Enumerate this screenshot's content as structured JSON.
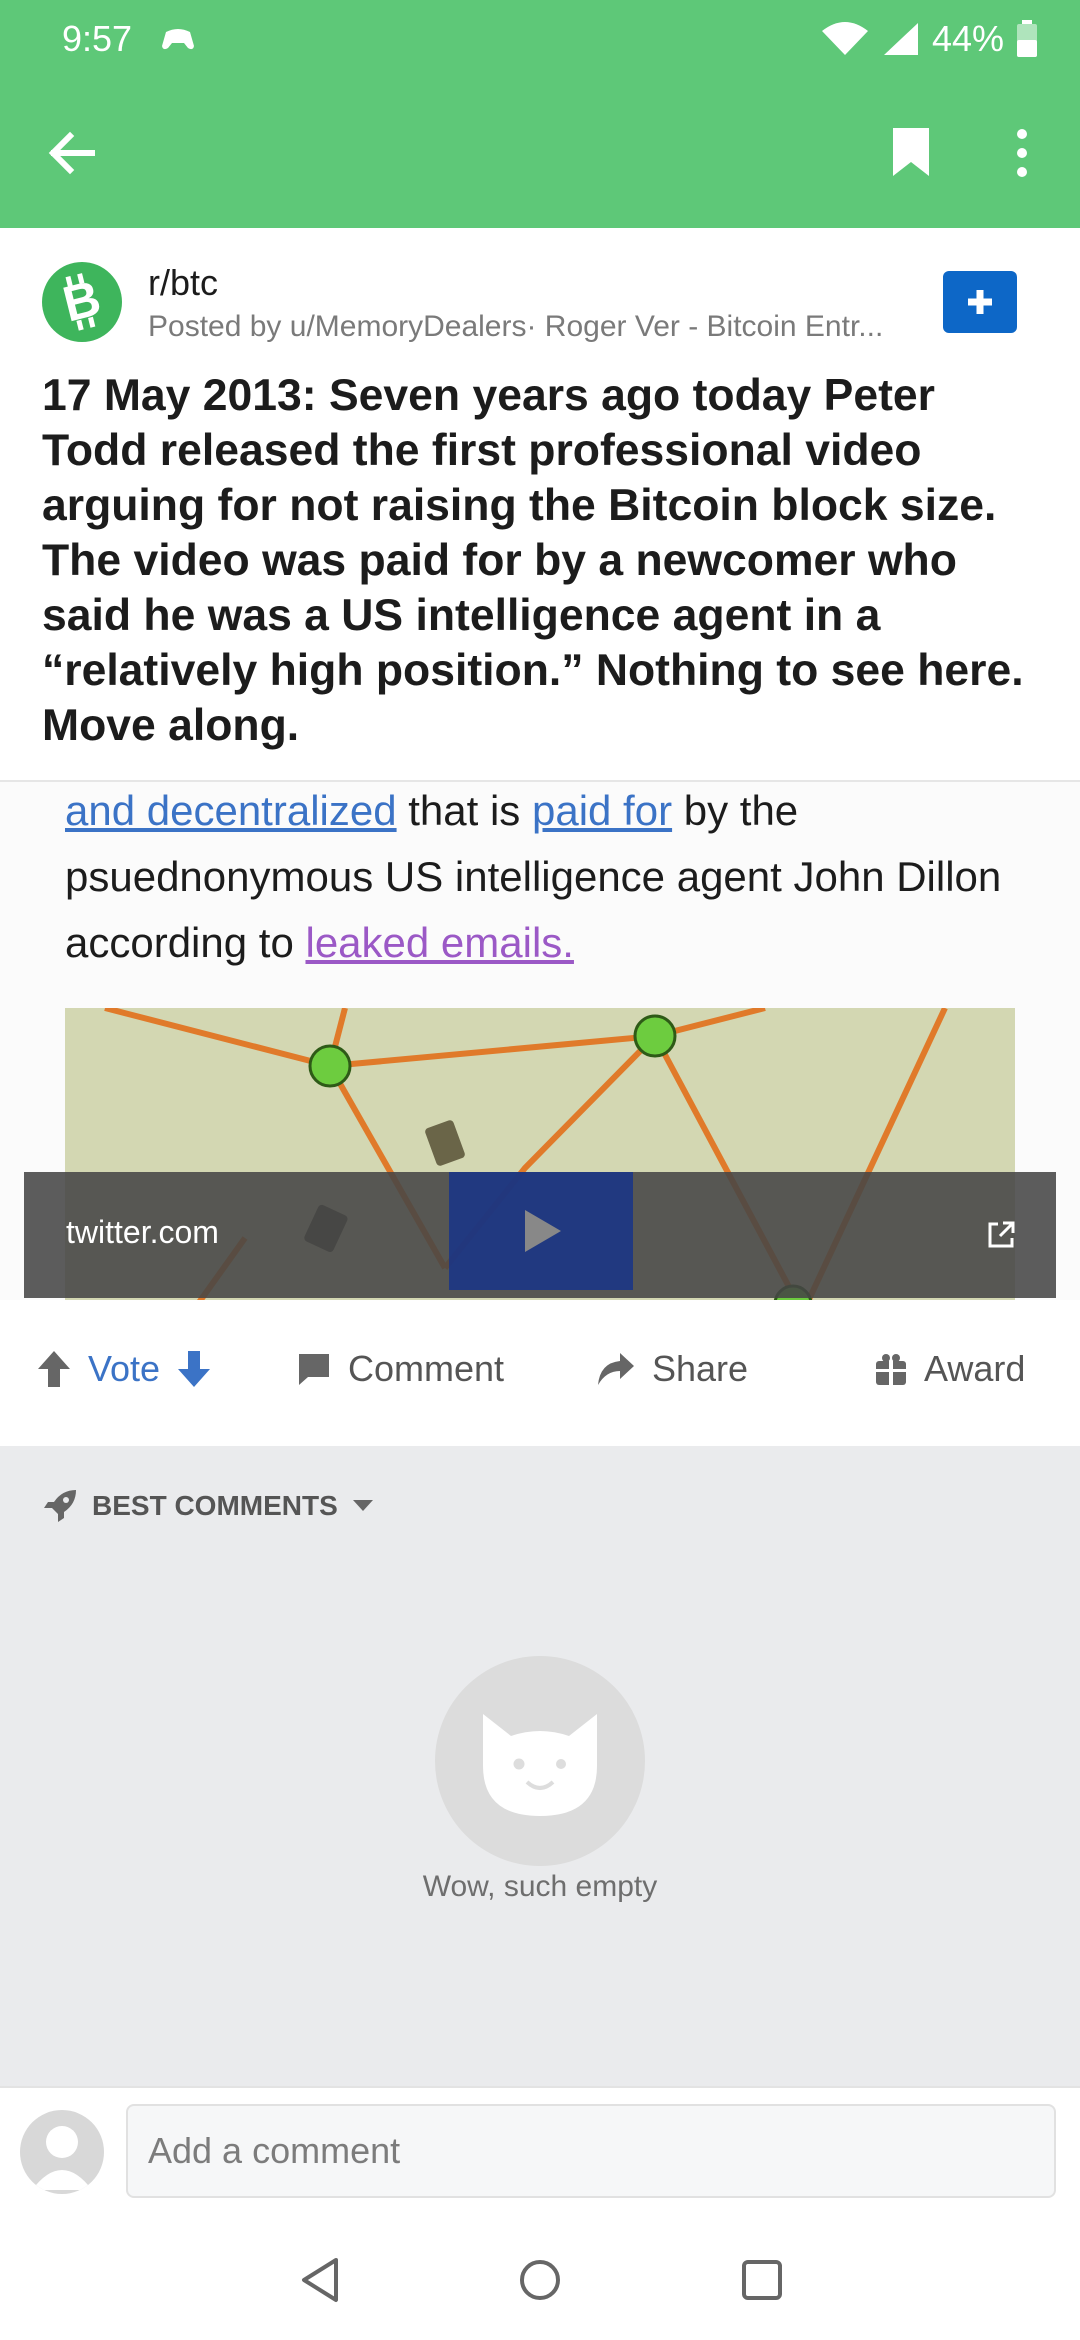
{
  "status_bar": {
    "time": "9:57",
    "battery": "44%"
  },
  "app_bar": {
    "icons": [
      "back-arrow-icon",
      "bookmark-icon",
      "overflow-menu-icon"
    ],
    "color": "#5ec878"
  },
  "post": {
    "subreddit": "r/btc",
    "posted_by": "Posted by u/MemoryDealers· Roger Ver - Bitcoin Entr...",
    "title": "17 May 2013: Seven years ago today Peter Todd released the first professional video arguing for not raising the Bitcoin block size. The video was paid for by a newcomer who said he was a US intelligence agent in a “relatively high position.” Nothing to see here. Move along."
  },
  "embed": {
    "link1": "and decentralized",
    "text1": " that is ",
    "link2": "paid for",
    "text2": " by the psuednonymous US intelligence agent John Dillon according to ",
    "link3": "leaked emails.",
    "domain": "twitter.com"
  },
  "actions": {
    "vote": "Vote",
    "comment": "Comment",
    "share": "Share",
    "award": "Award"
  },
  "comments": {
    "sort_label": "BEST COMMENTS",
    "empty_text": "Wow, such empty"
  },
  "composer": {
    "placeholder": "Add a comment"
  },
  "colors": {
    "accent": "#5ec878",
    "vote_blue": "#3b73c6",
    "join_blue": "#0d67c7"
  }
}
